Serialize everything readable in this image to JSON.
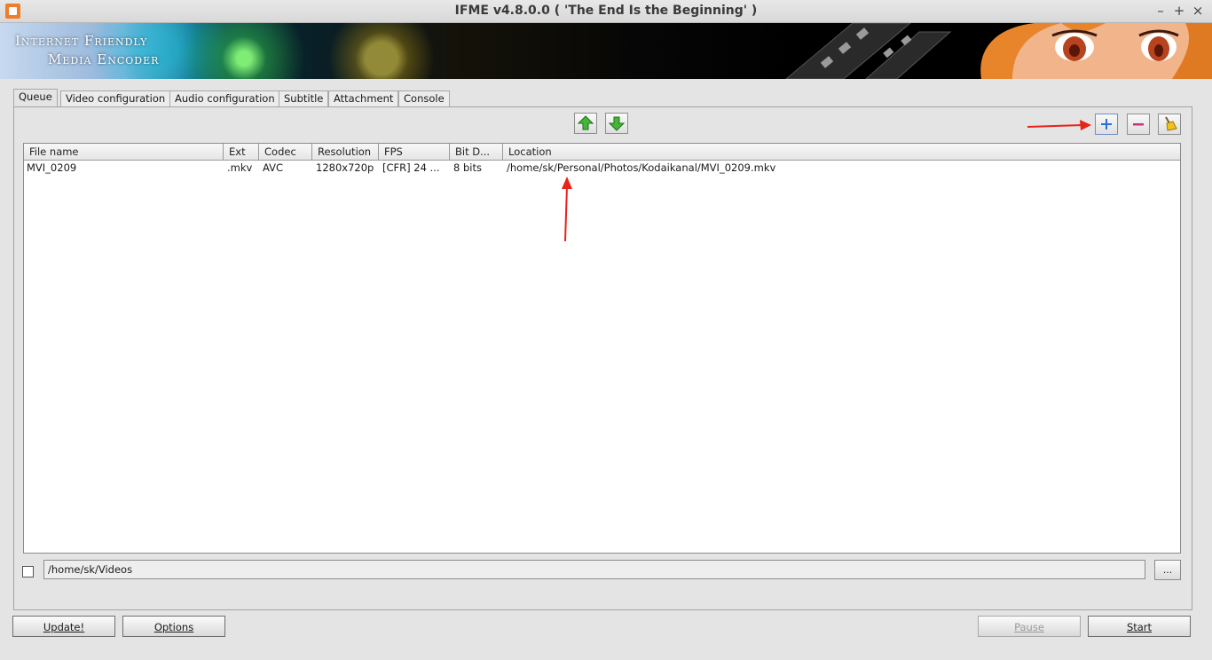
{
  "window": {
    "title": "IFME v4.8.0.0 ( 'The End Is the Beginning' )",
    "minimize": "–",
    "maximize": "+",
    "close": "×"
  },
  "banner": {
    "line1": "Internet Friendly",
    "line2": "Media Encoder"
  },
  "tabs": [
    {
      "label": "Queue",
      "active": true
    },
    {
      "label": "Video configuration"
    },
    {
      "label": "Audio configuration"
    },
    {
      "label": "Subtitle"
    },
    {
      "label": "Attachment"
    },
    {
      "label": "Console"
    }
  ],
  "queue": {
    "columns": [
      "File name",
      "Ext",
      "Codec",
      "Resolution",
      "FPS",
      "Bit D...",
      "Location"
    ],
    "rows": [
      {
        "file_name": "MVI_0209",
        "ext": ".mkv",
        "codec": "AVC",
        "resolution": "1280x720p",
        "fps": "[CFR] 24 ...",
        "bit_depth": "8 bits",
        "location": "/home/sk/Personal/Photos/Kodaikanal/MVI_0209.mkv"
      }
    ],
    "output_checked": false,
    "output_path": "/home/sk/Videos",
    "browse_label": "..."
  },
  "buttons": {
    "update": "Update!",
    "options": "Options",
    "pause": "Pause",
    "start": "Start"
  },
  "colors": {
    "annotation_arrow": "#e8231a",
    "move_arrow_green": "#3aa832",
    "add_blue": "#2a6fd6",
    "remove_magenta": "#d0307a"
  },
  "icons": {
    "move_up": "arrow-up-icon",
    "move_down": "arrow-down-icon",
    "add": "plus-icon",
    "remove": "minus-icon",
    "clear": "broom-icon"
  }
}
